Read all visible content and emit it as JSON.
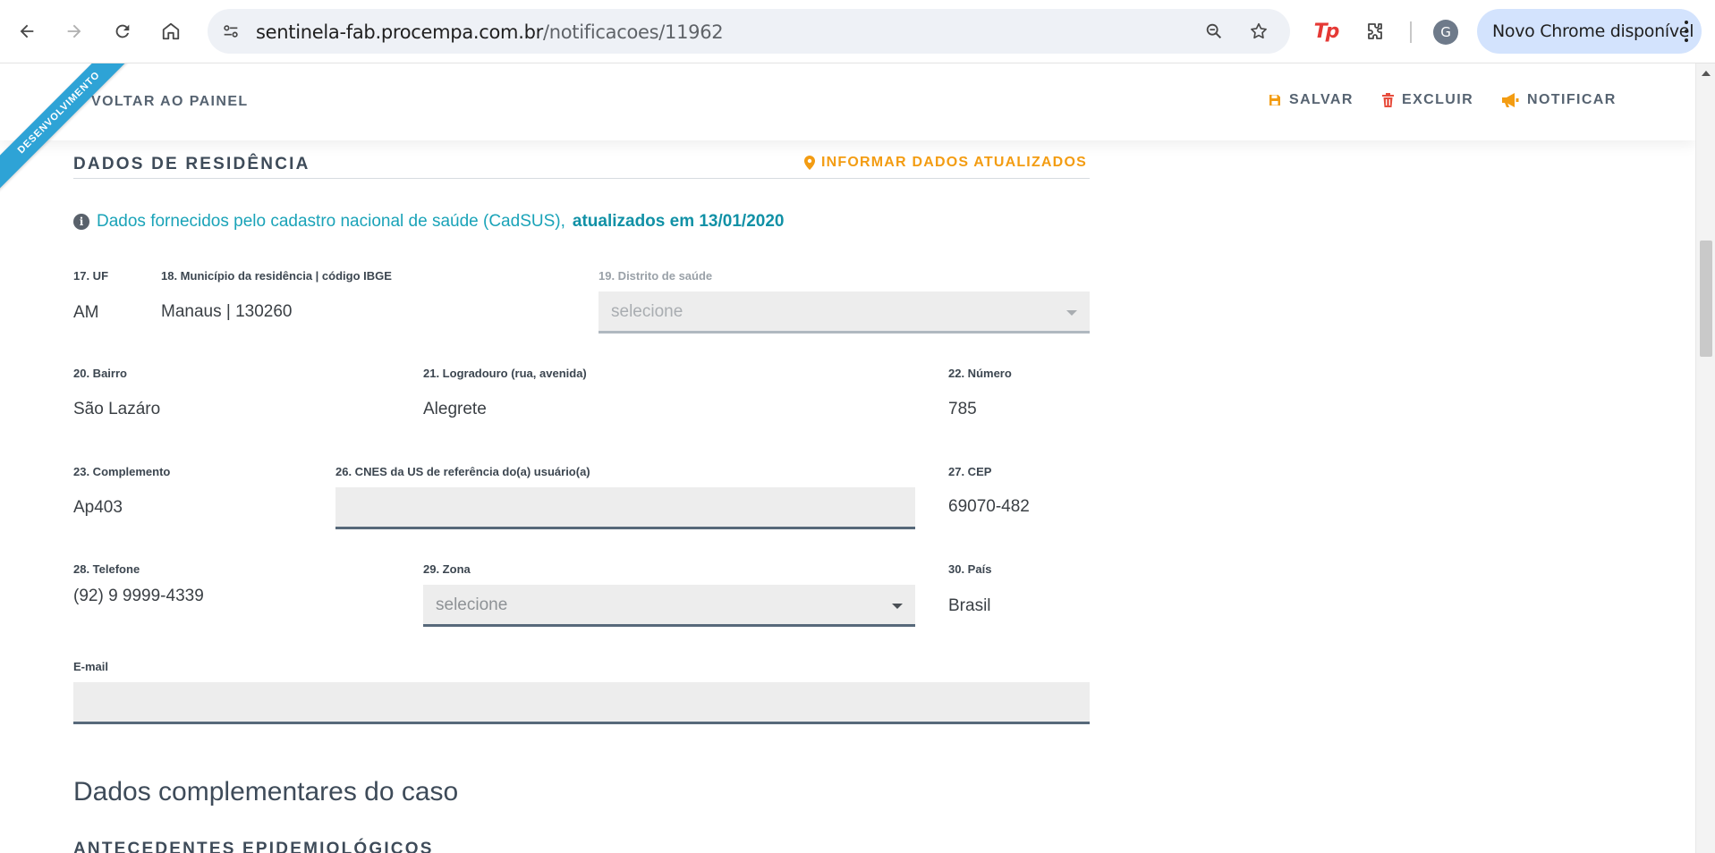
{
  "browser": {
    "url_domain": "sentinela-fab.procempa.com.br",
    "url_path": "/notificacoes/11962",
    "profile_initial": "G",
    "update_label": "Novo Chrome disponível",
    "extension_label": "Tp"
  },
  "env_ribbon": "DESENVOLVIMENTO",
  "topbar": {
    "back_label": "VOLTAR AO PAINEL",
    "save_label": "SALVAR",
    "delete_label": "EXCLUIR",
    "notify_label": "NOTIFICAR"
  },
  "section": {
    "title": "DADOS DE RESIDÊNCIA",
    "action_label": "INFORMAR DADOS ATUALIZADOS",
    "info_text": "Dados fornecidos pelo cadastro nacional de saúde (CadSUS),",
    "info_bold": "atualizados em 13/01/2020"
  },
  "fields": {
    "uf": {
      "label": "17. UF",
      "value": "AM"
    },
    "municipio": {
      "label": "18. Município da residência | código IBGE",
      "value": "Manaus | 130260"
    },
    "distrito": {
      "label": "19. Distrito de saúde",
      "placeholder": "selecione"
    },
    "bairro": {
      "label": "20. Bairro",
      "value": "São Lazáro"
    },
    "logradouro": {
      "label": "21. Logradouro (rua, avenida)",
      "value": "Alegrete"
    },
    "numero": {
      "label": "22. Número",
      "value": "785"
    },
    "complemento": {
      "label": "23. Complemento",
      "value": "Ap403"
    },
    "cnes": {
      "label": "26. CNES da US de referência do(a) usuário(a)",
      "value": ""
    },
    "cep": {
      "label": "27. CEP",
      "value": "69070-482"
    },
    "telefone": {
      "label": "28. Telefone",
      "value": "(92) 9 9999-4339"
    },
    "zona": {
      "label": "29. Zona",
      "placeholder": "selecione"
    },
    "pais": {
      "label": "30. País",
      "value": "Brasil"
    },
    "email": {
      "label": "E-mail",
      "value": ""
    }
  },
  "complementary": {
    "title": "Dados complementares do caso",
    "next_section": "ANTECEDENTES EPIDEMIOLÓGICOS"
  },
  "colors": {
    "accent_orange": "#f39c12",
    "delete_red": "#e74c3c",
    "info_teal": "#1aa3b8",
    "ribbon_blue": "#2ea3d6"
  }
}
